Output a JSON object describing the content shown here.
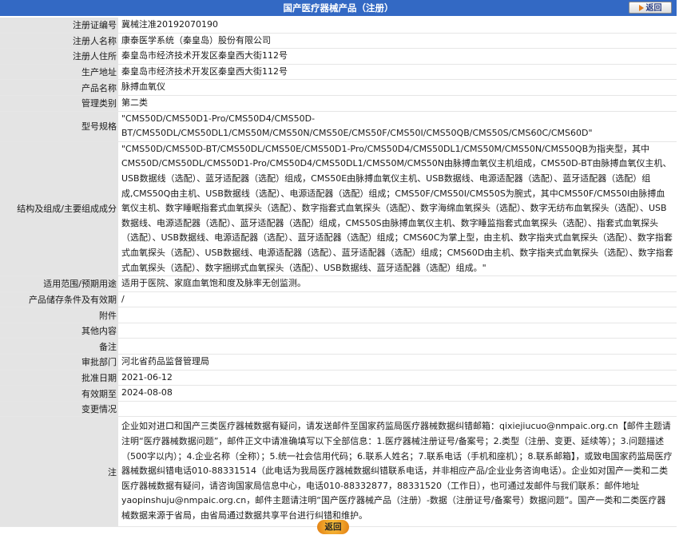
{
  "header": {
    "title": "国产医疗器械产品（注册）",
    "back_label": "返回"
  },
  "rows": [
    {
      "label": "注册证编号",
      "value": "冀械注准20192070190"
    },
    {
      "label": "注册人名称",
      "value": "康泰医学系统（秦皇岛）股份有限公司"
    },
    {
      "label": "注册人住所",
      "value": "秦皇岛市经济技术开发区秦皇西大街112号"
    },
    {
      "label": "生产地址",
      "value": "秦皇岛市经济技术开发区秦皇西大街112号"
    },
    {
      "label": "产品名称",
      "value": "脉搏血氧仪"
    },
    {
      "label": "管理类别",
      "value": "第二类"
    },
    {
      "label": "型号规格",
      "value": "\"CMS50D/CMS50D1-Pro/CMS50D4/CMS50D-BT/CMS50DL/CMS50DL1/CMS50M/CMS50N/CMS50E/CMS50F/CMS50I/CMS50QB/CMS50S/CMS60C/CMS60D\""
    },
    {
      "label": "结构及组成/主要组成成分",
      "value": "\"CMS50D/CMS50D-BT/CMS50DL/CMS50E/CMS50D1-Pro/CMS50D4/CMS50DL1/CMS50M/CMS50N/CMS50QB为指夹型，其中CMS50D/CMS50DL/CMS50D1-Pro/CMS50D4/CMS50DL1/CMS50M/CMS50N由脉搏血氧仪主机组成，CMS50D-BT由脉搏血氧仪主机、USB数据线（选配）、蓝牙适配器（选配）组成，CMS50E由脉搏血氧仪主机、USB数据线、电源适配器（选配）、蓝牙适配器（选配）组成,CMS50Q由主机、USB数据线（选配）、电源适配器（选配）组成；CMS50F/CMS50I/CMS50S为腕式，其中CMS50F/CMS50I由脉搏血氧仪主机、数字睡眠指套式血氧探头（选配）、数字指套式血氧探头（选配）、数字海绵血氧探头（选配）、数字无纺布血氧探头（选配）、USB数据线、电源适配器（选配）、蓝牙适配器（选配）组成，CMS50S由脉搏血氧仪主机、数字睡监指套式血氧探头（选配）、指套式血氧探头（选配）、USB数据线、电源适配器（选配）、蓝牙适配器（选配）组成；CMS60C为掌上型，由主机、数字指夹式血氧探头（选配）、数字指套式血氧探头（选配）、USB数据线、电源适配器（选配）、蓝牙适配器（选配）组成；CMS60D由主机、数字指夹式血氧探头（选配）、数字指套式血氧探头（选配）、数字捆绑式血氧探头（选配）、USB数据线、蓝牙适配器（选配）组成。\""
    },
    {
      "label": "适用范围/预期用途",
      "value": "适用于医院、家庭血氧饱和度及脉率无创监测。"
    },
    {
      "label": "产品储存条件及有效期",
      "value": "/"
    },
    {
      "label": "附件",
      "value": ""
    },
    {
      "label": "其他内容",
      "value": ""
    },
    {
      "label": "备注",
      "value": ""
    },
    {
      "label": "审批部门",
      "value": "河北省药品监督管理局"
    },
    {
      "label": "批准日期",
      "value": "2021-06-12"
    },
    {
      "label": "有效期至",
      "value": "2024-08-08"
    },
    {
      "label": "变更情况",
      "value": ""
    }
  ],
  "note_row": {
    "label": "注",
    "value": "企业如对进口和国产三类医疗器械数据有疑问，请发送邮件至国家药监局医疗器械数据纠错邮箱：qixiejiucuo@nmpaic.org.cn【邮件主题请注明“医疗器械数据问题”，邮件正文中请准确填写以下全部信息：1.医疗器械注册证号/备案号；2.类型（注册、变更、延续等）；3.问题描述（500字以内）；4.企业名称（全称）；5.统一社会信用代码；6.联系人姓名；7.联系电话（手机和座机）；8.联系邮箱】，或致电国家药监局医疗器械数据纠错电话010-88331514（此电话为我局医疗器械数据纠错联系电话，并非相应产品/企业业务咨询电话）。企业如对国产一类和二类医疗器械数据有疑问，请咨询国家局信息中心，电话010-88332877，88331520（工作日），也可通过发邮件与我们联系：邮件地址yaopinshuju@nmpaic.org.cn，邮件主题请注明“国产医疗器械产品（注册）-数据（注册证号/备案号）数据问题”。国产一类和二类医疗器械数据来源于省局，由省局通过数据共享平台进行纠错和维护。"
  },
  "footer": {
    "back_label": "返回"
  }
}
